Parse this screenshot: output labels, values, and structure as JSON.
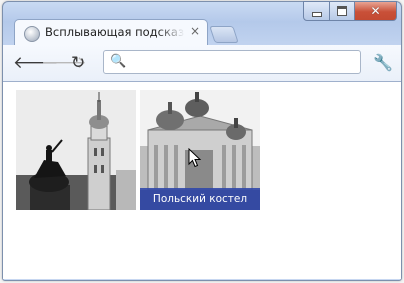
{
  "window": {
    "min_glyph": "minimize-icon",
    "max_glyph": "maximize-icon",
    "close_glyph": "close-icon"
  },
  "tab": {
    "title": "Всплывающая подсказка с",
    "close": "×"
  },
  "toolbar": {
    "back": "🡐",
    "forward": "🡒",
    "reload": "↻",
    "search_glyph": "🔍",
    "omnibox_value": "",
    "wrench": "🔧"
  },
  "page": {
    "tooltip_text": "Польский костел"
  }
}
